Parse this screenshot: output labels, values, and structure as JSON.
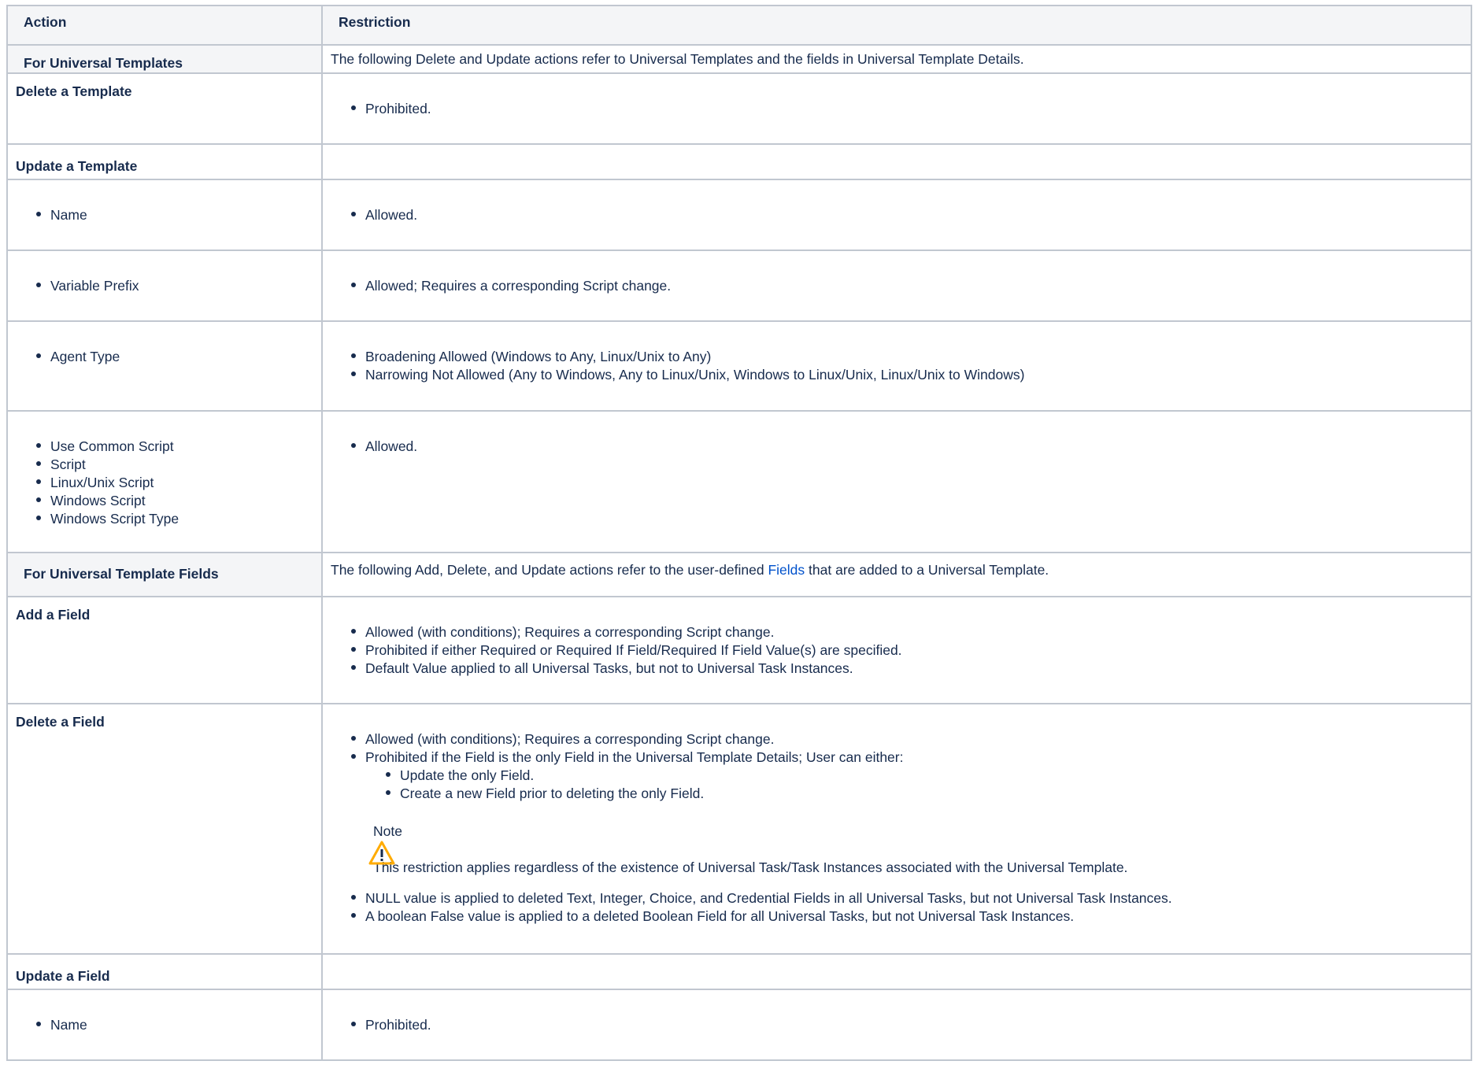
{
  "table": {
    "headers": {
      "action": "Action",
      "restriction": "Restriction"
    },
    "sections": {
      "templates": {
        "label": "For Universal Templates",
        "description": "The following Delete and Update actions refer to Universal Templates and the fields in Universal Template Details."
      },
      "fields": {
        "label": "For Universal Template Fields",
        "description_before": "The following Add, Delete, and Update actions refer to the user-defined ",
        "description_link": "Fields",
        "description_after": " that are added to a Universal Template."
      }
    },
    "rows": {
      "delete_template": {
        "action": "Delete a Template",
        "restrictions": [
          "Prohibited."
        ]
      },
      "update_template": {
        "action": "Update a Template"
      },
      "name": {
        "action": "Name",
        "restrictions": [
          "Allowed."
        ]
      },
      "variable_prefix": {
        "action": "Variable Prefix",
        "restrictions": [
          "Allowed; Requires a corresponding Script change."
        ]
      },
      "agent_type": {
        "action": "Agent Type",
        "restrictions": [
          "Broadening Allowed (Windows to Any, Linux/Unix to Any)",
          "Narrowing Not Allowed (Any to Windows, Any to Linux/Unix, Windows to Linux/Unix, Linux/Unix to Windows)"
        ]
      },
      "scripts": {
        "actions": [
          "Use Common Script",
          "Script",
          "Linux/Unix Script",
          "Windows Script",
          "Windows Script Type"
        ],
        "restrictions": [
          "Allowed."
        ]
      },
      "add_field": {
        "action": "Add a Field",
        "restrictions": [
          "Allowed (with conditions); Requires a corresponding Script change.",
          "Prohibited if either Required or Required If Field/Required If Field Value(s) are specified.",
          "Default Value applied to all Universal Tasks, but not to Universal Task Instances."
        ]
      },
      "delete_field": {
        "action": "Delete a Field",
        "restrictions": [
          "Allowed (with conditions); Requires a corresponding Script change.",
          "Prohibited if the Field is the only Field in the Universal Template Details; User can either:"
        ],
        "sub_restrictions": [
          "Update the only Field.",
          "Create a new Field prior to deleting the only Field."
        ],
        "note_title": "Note",
        "note_text": "This restriction applies regardless of the existence of Universal Task/Task Instances associated with the Universal Template.",
        "after_note": [
          "NULL value is applied to deleted Text, Integer, Choice, and Credential Fields in all Universal Tasks, but not Universal Task Instances.",
          "A boolean False value is applied to a deleted Boolean Field for all Universal Tasks, but not Universal Task Instances."
        ]
      },
      "update_field": {
        "action": "Update a Field"
      },
      "field_name": {
        "action": "Name",
        "restrictions": [
          "Prohibited."
        ]
      }
    }
  },
  "icons": {
    "note": "warning-icon"
  },
  "colors": {
    "header_bg": "#f4f5f7",
    "border": "#c1c7d0",
    "text": "#172b4d",
    "link": "#0052cc",
    "warning": "#ffab00"
  }
}
